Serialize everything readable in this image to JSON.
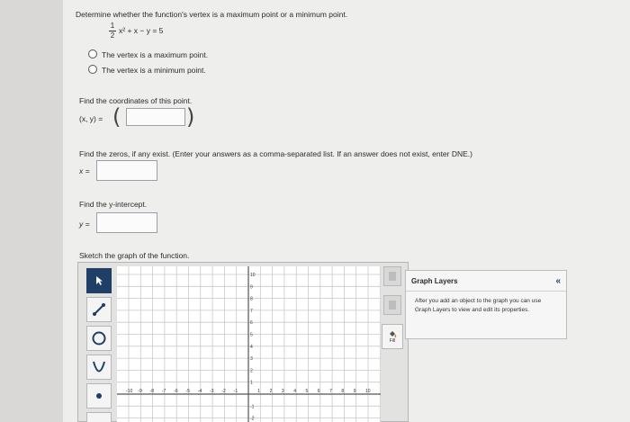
{
  "question": {
    "prompt": "Determine whether the function's vertex is a maximum point or a minimum point.",
    "equation": {
      "frac_num": "1",
      "frac_den": "2",
      "rest": "x² + x − y = 5"
    },
    "options": [
      "The vertex is a maximum point.",
      "The vertex is a minimum point."
    ]
  },
  "coords": {
    "label": "Find the coordinates of this point.",
    "xy_label": "(x, y) =",
    "value": ""
  },
  "zeros": {
    "label": "Find the zeros, if any exist. (Enter your answers as a comma-separated list. If an answer does not exist, enter DNE.)",
    "var_label": "x =",
    "value": ""
  },
  "yint": {
    "label": "Find the y-intercept.",
    "var_label": "y =",
    "value": ""
  },
  "sketch": {
    "label": "Sketch the graph of the function.",
    "tools": [
      "pointer-icon",
      "line-icon",
      "circle-icon",
      "parabola-icon",
      "point-icon"
    ],
    "side_tools": [
      "delete-icon",
      "clear-icon",
      "fill-icon"
    ],
    "fill_label": "Fill",
    "y_ticks": [
      "10",
      "9",
      "8",
      "7",
      "6",
      "5",
      "4",
      "3",
      "2",
      "1",
      "-1",
      "-2"
    ],
    "x_ticks": [
      "-10",
      "-9",
      "-8",
      "-7",
      "-6",
      "-5",
      "-4",
      "-3",
      "-2",
      "-1",
      "1",
      "2",
      "3",
      "4",
      "5",
      "6",
      "7",
      "8",
      "9",
      "10"
    ]
  },
  "graph_layers": {
    "title": "Graph Layers",
    "collapse": "«",
    "body": "After you add an object to the graph you can use Graph Layers to view and edit its properties."
  }
}
